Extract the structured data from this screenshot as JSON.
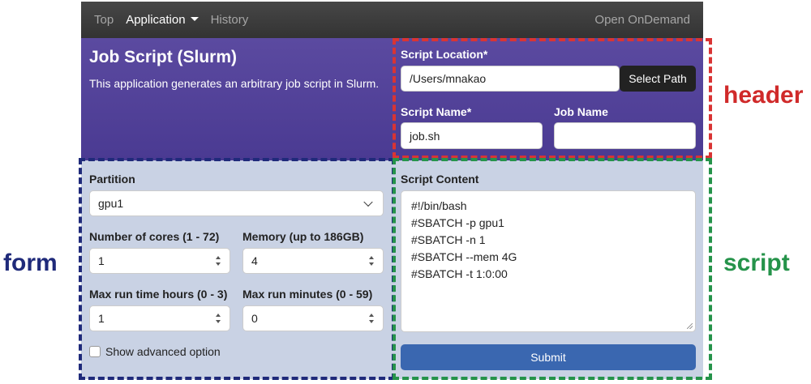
{
  "navbar": {
    "items": [
      {
        "label": "Top",
        "active": false
      },
      {
        "label": "Application",
        "active": true,
        "dropdown": true
      },
      {
        "label": "History",
        "active": false
      }
    ],
    "brand": "Open OnDemand"
  },
  "header": {
    "title": "Job Script (Slurm)",
    "description": "This application generates an arbitrary job script in Slurm.",
    "script_location": {
      "label": "Script Location*",
      "value": "/Users/mnakao",
      "button": "Select Path"
    },
    "script_name": {
      "label": "Script Name*",
      "value": "job.sh"
    },
    "job_name": {
      "label": "Job Name",
      "value": ""
    }
  },
  "form": {
    "partition": {
      "label": "Partition",
      "value": "gpu1"
    },
    "cores": {
      "label": "Number of cores (1 - 72)",
      "value": "1"
    },
    "memory": {
      "label": "Memory (up to 186GB)",
      "value": "4"
    },
    "hours": {
      "label": "Max run time hours (0 - 3)",
      "value": "1"
    },
    "minutes": {
      "label": "Max run minutes (0 - 59)",
      "value": "0"
    },
    "advanced": {
      "label": "Show advanced option",
      "checked": false
    }
  },
  "script": {
    "label": "Script Content",
    "lines": [
      "#!/bin/bash",
      "#SBATCH -p gpu1",
      "#SBATCH -n 1",
      "#SBATCH --mem 4G",
      "#SBATCH -t 1:0:00"
    ],
    "submit": "Submit"
  },
  "regions": {
    "header": "header",
    "form": "form",
    "script": "script"
  },
  "colors": {
    "header_bg": "#4f3f96",
    "body_bg": "#c9d2e4",
    "submit": "#3a67b0",
    "header_region": "#d93434",
    "form_region": "#1f2a7a",
    "script_region": "#25934a"
  }
}
